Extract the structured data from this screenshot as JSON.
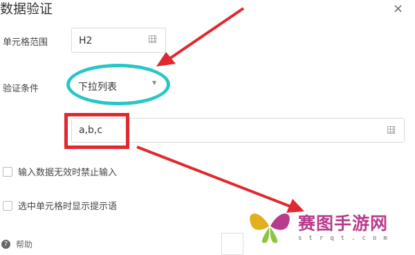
{
  "dialog": {
    "title": "数据验证",
    "close_glyph": "×"
  },
  "range": {
    "label": "单元格范围",
    "value": "H2"
  },
  "condition": {
    "label": "验证条件",
    "selected": "下拉列表"
  },
  "list_source": {
    "value": "a,b,c"
  },
  "options": [
    {
      "label": "输入数据无效时禁止输入",
      "checked": false
    },
    {
      "label": "选中单元格时显示提示语",
      "checked": false
    }
  ],
  "footer": {
    "help_label": "帮助"
  },
  "watermark": {
    "title": "赛图手游网",
    "subtitle": "strqt.com"
  },
  "colors": {
    "highlight_ellipse": "#27c6c9",
    "highlight_rect": "#e0282e",
    "arrow": "#e0282e",
    "watermark_text": "#b83b8c"
  },
  "icons": [
    "close-icon",
    "grid-icon",
    "chevron-down-icon",
    "help-icon",
    "checkbox-icon"
  ]
}
